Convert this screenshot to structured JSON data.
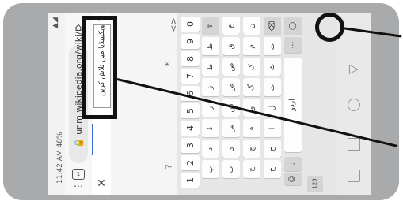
{
  "status_bar": {
    "time_text": "11:42 AM",
    "battery": "48%"
  },
  "browser": {
    "url": "ur.m.wikipedia.org/wiki/",
    "search_text": "ویکیپیڈیا میں تلاش کریں",
    "icons": {
      "home": "home-icon",
      "menu": "menu-dots-icon",
      "tabs": "tabs-count-icon",
      "lock": "lock-icon",
      "search": "search-icon",
      "close": "close-icon"
    }
  },
  "keyboard": {
    "numbers": [
      "0",
      "9",
      "8",
      "7",
      "6",
      "5",
      "4",
      "3",
      "2",
      "1"
    ],
    "special_keys": {
      "mic": "mic-icon",
      "language": "اردو",
      "num_switch": "123",
      "emoji": "emoji-icon"
    },
    "alt_symbols": [
      "<>",
      "*",
      "?"
    ],
    "letter_rows": [
      [
        "ظ",
        "ط",
        "ز",
        "ر",
        "ڈ",
        "د",
        "پ",
        "ت",
        "ٹ",
        "ث"
      ],
      [
        "ع",
        "ق",
        "ص",
        "ض",
        "ش",
        "س",
        "ی",
        "ب",
        "ل",
        "ا"
      ],
      [
        "ن",
        "م",
        "ک",
        "گ",
        "و",
        "ہ",
        "چ",
        "ج",
        "ح",
        "خ"
      ]
    ]
  },
  "navigation": {
    "back": "back-triangle-icon",
    "home": "home-circle-icon",
    "recents": "recents-square-icon"
  },
  "annotations": {
    "highlight_1": "search-field-highlight",
    "highlight_2": "mic-highlight"
  }
}
